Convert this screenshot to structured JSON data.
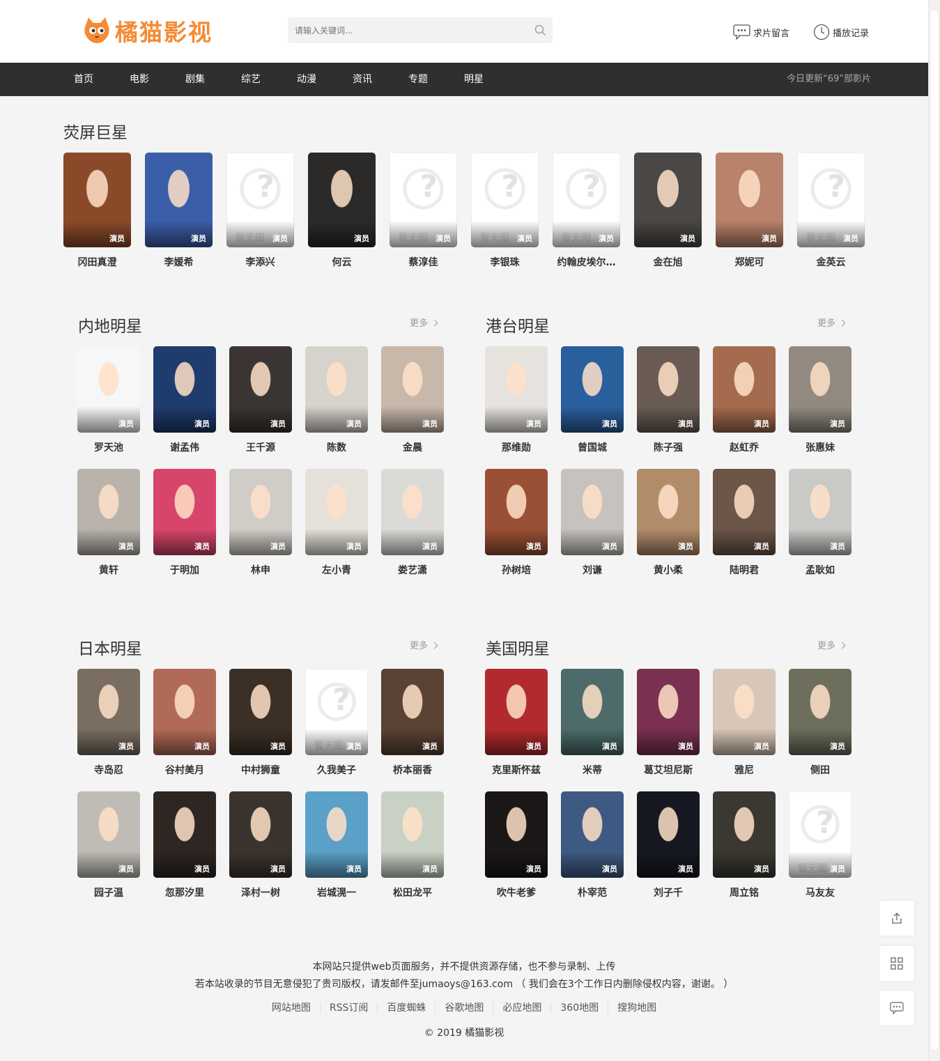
{
  "brand": {
    "name": "橘猫影视",
    "color": "#f48b33"
  },
  "search": {
    "placeholder": "请输入关键词..."
  },
  "top_links": {
    "message": "求片留言",
    "history": "播放记录"
  },
  "nav": {
    "items": [
      "首页",
      "电影",
      "剧集",
      "综艺",
      "动漫",
      "资讯",
      "专题",
      "明星"
    ],
    "update_text": "今日更新“69”部影片"
  },
  "tag_label": "演员",
  "placeholder_text": "暂无图",
  "featured": {
    "title": "荧屏巨星",
    "stars": [
      {
        "name": "冈田真澄",
        "color": "#8a4a2a",
        "has_photo": true
      },
      {
        "name": "李媛希",
        "color": "#3b5ea8",
        "has_photo": true
      },
      {
        "name": "李添兴",
        "has_photo": false
      },
      {
        "name": "何云",
        "color": "#2b2a28",
        "has_photo": true
      },
      {
        "name": "蔡淳佳",
        "has_photo": false
      },
      {
        "name": "李银珠",
        "has_photo": false
      },
      {
        "name": "约翰皮埃尔…",
        "has_photo": false
      },
      {
        "name": "金在旭",
        "color": "#4a4744",
        "has_photo": true
      },
      {
        "name": "郑妮可",
        "color": "#b9826a",
        "has_photo": true
      },
      {
        "name": "金英云",
        "has_photo": false
      }
    ]
  },
  "sections": [
    {
      "title": "内地明星",
      "more": "更多",
      "stars": [
        {
          "name": "罗天池",
          "color": "#f7f7f7",
          "has_photo": true
        },
        {
          "name": "谢孟伟",
          "color": "#1e3c6e",
          "has_photo": true
        },
        {
          "name": "王千源",
          "color": "#3a3532",
          "has_photo": true
        },
        {
          "name": "陈数",
          "color": "#d6d2cc",
          "has_photo": true
        },
        {
          "name": "金晨",
          "color": "#c8b8aa",
          "has_photo": true
        },
        {
          "name": "黄轩",
          "color": "#b9b3ac",
          "has_photo": true
        },
        {
          "name": "于明加",
          "color": "#d8456a",
          "has_photo": true
        },
        {
          "name": "林申",
          "color": "#d0ccc6",
          "has_photo": true
        },
        {
          "name": "左小青",
          "color": "#e5e1da",
          "has_photo": true
        },
        {
          "name": "娄艺潇",
          "color": "#dcdad6",
          "has_photo": true
        }
      ]
    },
    {
      "title": "港台明星",
      "more": "更多",
      "stars": [
        {
          "name": "那维勋",
          "color": "#e6e3de",
          "has_photo": true
        },
        {
          "name": "曾国城",
          "color": "#2a5f9e",
          "has_photo": true
        },
        {
          "name": "陈子强",
          "color": "#6a5c54",
          "has_photo": true
        },
        {
          "name": "赵虹乔",
          "color": "#a56b4e",
          "has_photo": true
        },
        {
          "name": "张惠妹",
          "color": "#928a80",
          "has_photo": true
        },
        {
          "name": "孙树培",
          "color": "#9a5034",
          "has_photo": true
        },
        {
          "name": "刘谦",
          "color": "#c6c2bd",
          "has_photo": true
        },
        {
          "name": "黄小柔",
          "color": "#b28c6a",
          "has_photo": true
        },
        {
          "name": "陆明君",
          "color": "#6b5648",
          "has_photo": true
        },
        {
          "name": "孟耿如",
          "color": "#c9c9c6",
          "has_photo": true
        }
      ]
    },
    {
      "title": "日本明星",
      "more": "更多",
      "stars": [
        {
          "name": "寺岛忍",
          "color": "#7a6d62",
          "has_photo": true
        },
        {
          "name": "谷村美月",
          "color": "#b26a58",
          "has_photo": true
        },
        {
          "name": "中村狮童",
          "color": "#3c3026",
          "has_photo": true
        },
        {
          "name": "久我美子",
          "has_photo": false
        },
        {
          "name": "桥本丽香",
          "color": "#5a4234",
          "has_photo": true
        },
        {
          "name": "园子温",
          "color": "#bfbcb6",
          "has_photo": true
        },
        {
          "name": "忽那汐里",
          "color": "#2e2623",
          "has_photo": true
        },
        {
          "name": "泽村一树",
          "color": "#3b342e",
          "has_photo": true
        },
        {
          "name": "岩城滉一",
          "color": "#5aa0c8",
          "has_photo": true
        },
        {
          "name": "松田龙平",
          "color": "#c8d1c4",
          "has_photo": true
        }
      ]
    },
    {
      "title": "美国明星",
      "more": "更多",
      "stars": [
        {
          "name": "克里斯怀兹",
          "color": "#b22a2e",
          "has_photo": true
        },
        {
          "name": "米蒂",
          "color": "#4c6b6a",
          "has_photo": true
        },
        {
          "name": "葛艾坦尼斯",
          "color": "#7a3050",
          "has_photo": true
        },
        {
          "name": "雅尼",
          "color": "#d8c6b6",
          "has_photo": true
        },
        {
          "name": "侧田",
          "color": "#6d6e5c",
          "has_photo": true
        },
        {
          "name": "吹牛老爹",
          "color": "#1a1716",
          "has_photo": true
        },
        {
          "name": "朴宰范",
          "color": "#3f5a82",
          "has_photo": true
        },
        {
          "name": "刘子千",
          "color": "#151820",
          "has_photo": true
        },
        {
          "name": "周立铭",
          "color": "#3a3830",
          "has_photo": true
        },
        {
          "name": "马友友",
          "has_photo": false
        }
      ]
    }
  ],
  "footer": {
    "line1": "本网站只提供web页面服务，并不提供资源存储，也不参与录制、上传",
    "line2": "若本站收录的节目无意侵犯了贵司版权，请发邮件至jumaoys@163.com （ 我们会在3个工作日内删除侵权内容，谢谢。 ）",
    "links": [
      "网站地图",
      "RSS订阅",
      "百度蜘蛛",
      "谷歌地图",
      "必应地图",
      "360地图",
      "搜狗地图"
    ],
    "copyright": "© 2019 橘猫影视"
  }
}
